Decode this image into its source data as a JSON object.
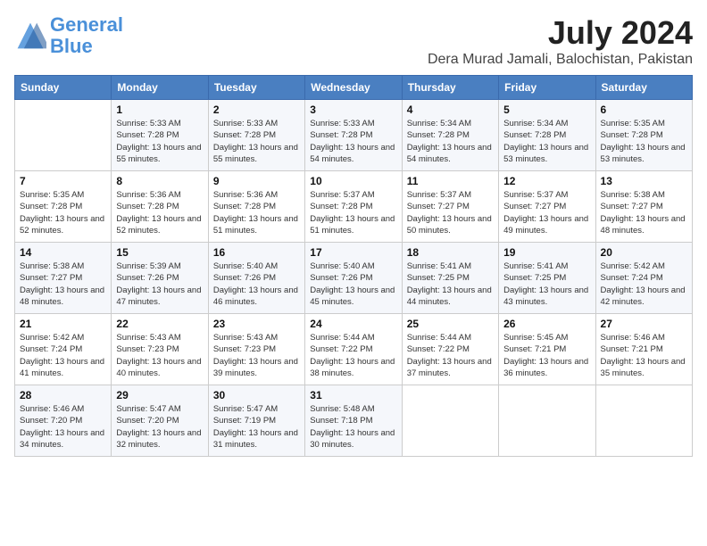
{
  "logo": {
    "line1": "General",
    "line2": "Blue"
  },
  "title": "July 2024",
  "location": "Dera Murad Jamali, Balochistan, Pakistan",
  "days_of_week": [
    "Sunday",
    "Monday",
    "Tuesday",
    "Wednesday",
    "Thursday",
    "Friday",
    "Saturday"
  ],
  "weeks": [
    [
      {
        "day": "",
        "sunrise": "",
        "sunset": "",
        "daylight": ""
      },
      {
        "day": "1",
        "sunrise": "Sunrise: 5:33 AM",
        "sunset": "Sunset: 7:28 PM",
        "daylight": "Daylight: 13 hours and 55 minutes."
      },
      {
        "day": "2",
        "sunrise": "Sunrise: 5:33 AM",
        "sunset": "Sunset: 7:28 PM",
        "daylight": "Daylight: 13 hours and 55 minutes."
      },
      {
        "day": "3",
        "sunrise": "Sunrise: 5:33 AM",
        "sunset": "Sunset: 7:28 PM",
        "daylight": "Daylight: 13 hours and 54 minutes."
      },
      {
        "day": "4",
        "sunrise": "Sunrise: 5:34 AM",
        "sunset": "Sunset: 7:28 PM",
        "daylight": "Daylight: 13 hours and 54 minutes."
      },
      {
        "day": "5",
        "sunrise": "Sunrise: 5:34 AM",
        "sunset": "Sunset: 7:28 PM",
        "daylight": "Daylight: 13 hours and 53 minutes."
      },
      {
        "day": "6",
        "sunrise": "Sunrise: 5:35 AM",
        "sunset": "Sunset: 7:28 PM",
        "daylight": "Daylight: 13 hours and 53 minutes."
      }
    ],
    [
      {
        "day": "7",
        "sunrise": "Sunrise: 5:35 AM",
        "sunset": "Sunset: 7:28 PM",
        "daylight": "Daylight: 13 hours and 52 minutes."
      },
      {
        "day": "8",
        "sunrise": "Sunrise: 5:36 AM",
        "sunset": "Sunset: 7:28 PM",
        "daylight": "Daylight: 13 hours and 52 minutes."
      },
      {
        "day": "9",
        "sunrise": "Sunrise: 5:36 AM",
        "sunset": "Sunset: 7:28 PM",
        "daylight": "Daylight: 13 hours and 51 minutes."
      },
      {
        "day": "10",
        "sunrise": "Sunrise: 5:37 AM",
        "sunset": "Sunset: 7:28 PM",
        "daylight": "Daylight: 13 hours and 51 minutes."
      },
      {
        "day": "11",
        "sunrise": "Sunrise: 5:37 AM",
        "sunset": "Sunset: 7:27 PM",
        "daylight": "Daylight: 13 hours and 50 minutes."
      },
      {
        "day": "12",
        "sunrise": "Sunrise: 5:37 AM",
        "sunset": "Sunset: 7:27 PM",
        "daylight": "Daylight: 13 hours and 49 minutes."
      },
      {
        "day": "13",
        "sunrise": "Sunrise: 5:38 AM",
        "sunset": "Sunset: 7:27 PM",
        "daylight": "Daylight: 13 hours and 48 minutes."
      }
    ],
    [
      {
        "day": "14",
        "sunrise": "Sunrise: 5:38 AM",
        "sunset": "Sunset: 7:27 PM",
        "daylight": "Daylight: 13 hours and 48 minutes."
      },
      {
        "day": "15",
        "sunrise": "Sunrise: 5:39 AM",
        "sunset": "Sunset: 7:26 PM",
        "daylight": "Daylight: 13 hours and 47 minutes."
      },
      {
        "day": "16",
        "sunrise": "Sunrise: 5:40 AM",
        "sunset": "Sunset: 7:26 PM",
        "daylight": "Daylight: 13 hours and 46 minutes."
      },
      {
        "day": "17",
        "sunrise": "Sunrise: 5:40 AM",
        "sunset": "Sunset: 7:26 PM",
        "daylight": "Daylight: 13 hours and 45 minutes."
      },
      {
        "day": "18",
        "sunrise": "Sunrise: 5:41 AM",
        "sunset": "Sunset: 7:25 PM",
        "daylight": "Daylight: 13 hours and 44 minutes."
      },
      {
        "day": "19",
        "sunrise": "Sunrise: 5:41 AM",
        "sunset": "Sunset: 7:25 PM",
        "daylight": "Daylight: 13 hours and 43 minutes."
      },
      {
        "day": "20",
        "sunrise": "Sunrise: 5:42 AM",
        "sunset": "Sunset: 7:24 PM",
        "daylight": "Daylight: 13 hours and 42 minutes."
      }
    ],
    [
      {
        "day": "21",
        "sunrise": "Sunrise: 5:42 AM",
        "sunset": "Sunset: 7:24 PM",
        "daylight": "Daylight: 13 hours and 41 minutes."
      },
      {
        "day": "22",
        "sunrise": "Sunrise: 5:43 AM",
        "sunset": "Sunset: 7:23 PM",
        "daylight": "Daylight: 13 hours and 40 minutes."
      },
      {
        "day": "23",
        "sunrise": "Sunrise: 5:43 AM",
        "sunset": "Sunset: 7:23 PM",
        "daylight": "Daylight: 13 hours and 39 minutes."
      },
      {
        "day": "24",
        "sunrise": "Sunrise: 5:44 AM",
        "sunset": "Sunset: 7:22 PM",
        "daylight": "Daylight: 13 hours and 38 minutes."
      },
      {
        "day": "25",
        "sunrise": "Sunrise: 5:44 AM",
        "sunset": "Sunset: 7:22 PM",
        "daylight": "Daylight: 13 hours and 37 minutes."
      },
      {
        "day": "26",
        "sunrise": "Sunrise: 5:45 AM",
        "sunset": "Sunset: 7:21 PM",
        "daylight": "Daylight: 13 hours and 36 minutes."
      },
      {
        "day": "27",
        "sunrise": "Sunrise: 5:46 AM",
        "sunset": "Sunset: 7:21 PM",
        "daylight": "Daylight: 13 hours and 35 minutes."
      }
    ],
    [
      {
        "day": "28",
        "sunrise": "Sunrise: 5:46 AM",
        "sunset": "Sunset: 7:20 PM",
        "daylight": "Daylight: 13 hours and 34 minutes."
      },
      {
        "day": "29",
        "sunrise": "Sunrise: 5:47 AM",
        "sunset": "Sunset: 7:20 PM",
        "daylight": "Daylight: 13 hours and 32 minutes."
      },
      {
        "day": "30",
        "sunrise": "Sunrise: 5:47 AM",
        "sunset": "Sunset: 7:19 PM",
        "daylight": "Daylight: 13 hours and 31 minutes."
      },
      {
        "day": "31",
        "sunrise": "Sunrise: 5:48 AM",
        "sunset": "Sunset: 7:18 PM",
        "daylight": "Daylight: 13 hours and 30 minutes."
      },
      {
        "day": "",
        "sunrise": "",
        "sunset": "",
        "daylight": ""
      },
      {
        "day": "",
        "sunrise": "",
        "sunset": "",
        "daylight": ""
      },
      {
        "day": "",
        "sunrise": "",
        "sunset": "",
        "daylight": ""
      }
    ]
  ]
}
